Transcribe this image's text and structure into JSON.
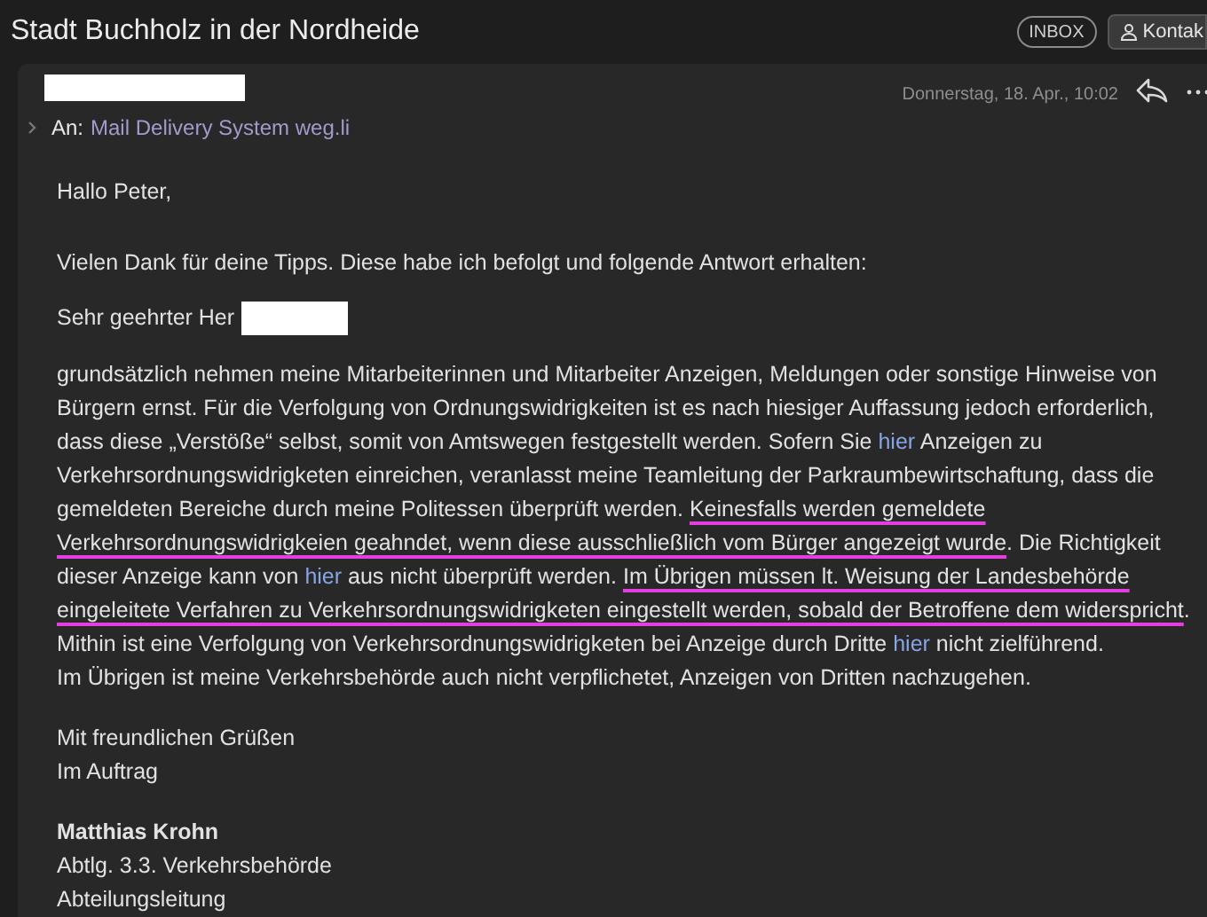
{
  "header": {
    "title": "Stadt Buchholz in der Nordheide",
    "folder_badge": "INBOX",
    "contact_button": "Kontak"
  },
  "message": {
    "to_label": "An:",
    "to": "Mail Delivery System weg.li",
    "date": "Donnerstag, 18. Apr., 10:02",
    "greeting": "Hallo Peter,",
    "intro": "Vielen Dank für deine Tipps. Diese habe ich befolgt und folgende Antwort erhalten:",
    "salutation": "Sehr geehrter Her",
    "body": [
      {
        "kind": "text",
        "text": "grundsätzlich nehmen meine Mitarbeiterinnen und Mitarbeiter Anzeigen, Meldungen oder sonstige Hinweise von Bürgern ernst. Für die Verfolgung von Ordnungswidrigkeiten ist es nach hiesiger Auffassung jedoch erforderlich, dass diese „Verstöße“ selbst, somit von Amtswegen festgestellt werden. Sofern Sie "
      },
      {
        "kind": "link",
        "text": "hier"
      },
      {
        "kind": "text",
        "text": " Anzeigen zu Verkehrsordnungswidrigketen einreichen, veranlasst meine Teamleitung der Parkraumbewirtschaftung, dass die gemeldeten Bereiche durch meine Politessen überprüft werden. "
      },
      {
        "kind": "text",
        "marked": true,
        "text": "Keinesfalls werden gemeldete Verkehrsordnungswidrigkeien geahndet, wenn diese ausschließlich vom Bürger angezeigt wurde"
      },
      {
        "kind": "text",
        "text": ". Die Richtigkeit dieser Anzeige kann von "
      },
      {
        "kind": "link",
        "text": "hier"
      },
      {
        "kind": "text",
        "text": " aus nicht überprüft werden. "
      },
      {
        "kind": "text",
        "marked": true,
        "text": "Im Übrigen müssen lt. Weisung der Landesbehörde eingeleitete Verfahren zu Verkehrsordnungswidrigketen eingestellt werden, sobald der Betroffene dem widerspricht"
      },
      {
        "kind": "text",
        "text": ". Mithin ist eine Verfolgung von Verkehrsordnungswidrigketen bei Anzeige durch Dritte "
      },
      {
        "kind": "link",
        "text": "hier"
      },
      {
        "kind": "text",
        "text": " nicht zielführend."
      },
      {
        "kind": "break"
      },
      {
        "kind": "text",
        "text": "Im Übrigen ist meine Verkehrsbehörde auch nicht verpflichetet, Anzeigen von Dritten nachzugehen."
      }
    ],
    "closing": [
      "Mit freundlichen Grüßen",
      "Im Auftrag"
    ],
    "signature": [
      {
        "text": "Matthias Krohn",
        "bold": true
      },
      {
        "text": "Abtlg. 3.3. Verkehrsbehörde",
        "bold": false
      },
      {
        "text": "Abteilungsleitung",
        "bold": false
      }
    ]
  }
}
